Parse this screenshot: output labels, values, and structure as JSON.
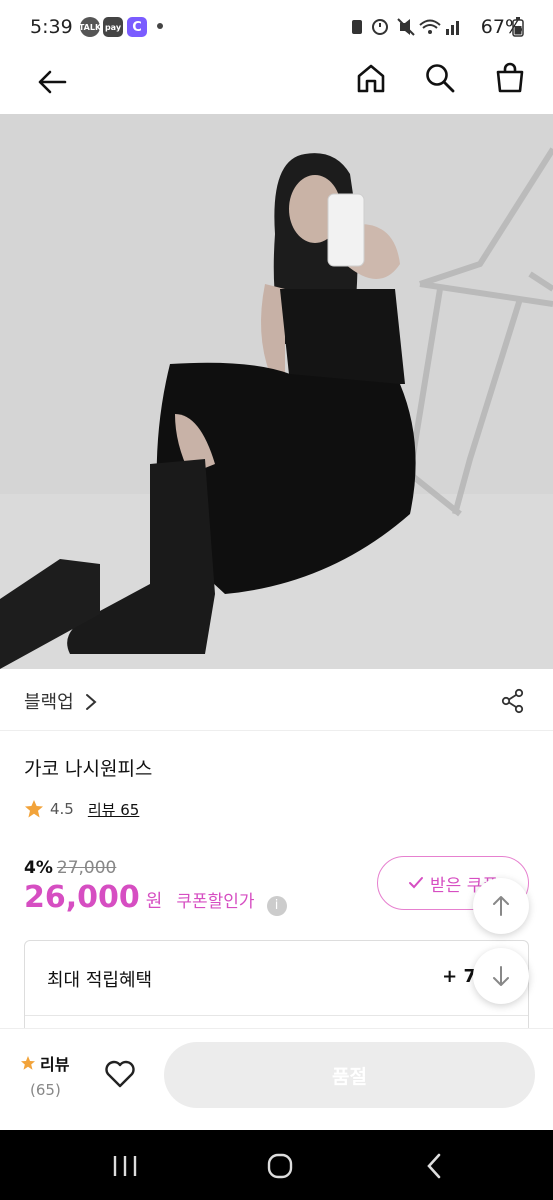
{
  "status_bar": {
    "time": "5:39",
    "badges": [
      "TALK",
      "pay",
      "C"
    ],
    "battery_text": "67%"
  },
  "brand": {
    "name": "블랙업"
  },
  "product": {
    "title": "가코 나시원피스",
    "rating": "4.5",
    "review_link": "리뷰 65",
    "discount_pct": "4%",
    "original_price": "27,000",
    "price": "26,000",
    "currency": "원",
    "price_note": "쿠폰할인가",
    "info_glyph": "i"
  },
  "coupon_button": {
    "label": "받은 쿠폰"
  },
  "points": {
    "label": "최대 적립혜택",
    "value": "+ 7"
  },
  "bottom_bar": {
    "review_label": "리뷰",
    "review_count": "(65)",
    "soldout_label": "품절"
  },
  "colors": {
    "accent": "#d64ec2",
    "star": "#f2a33a"
  }
}
